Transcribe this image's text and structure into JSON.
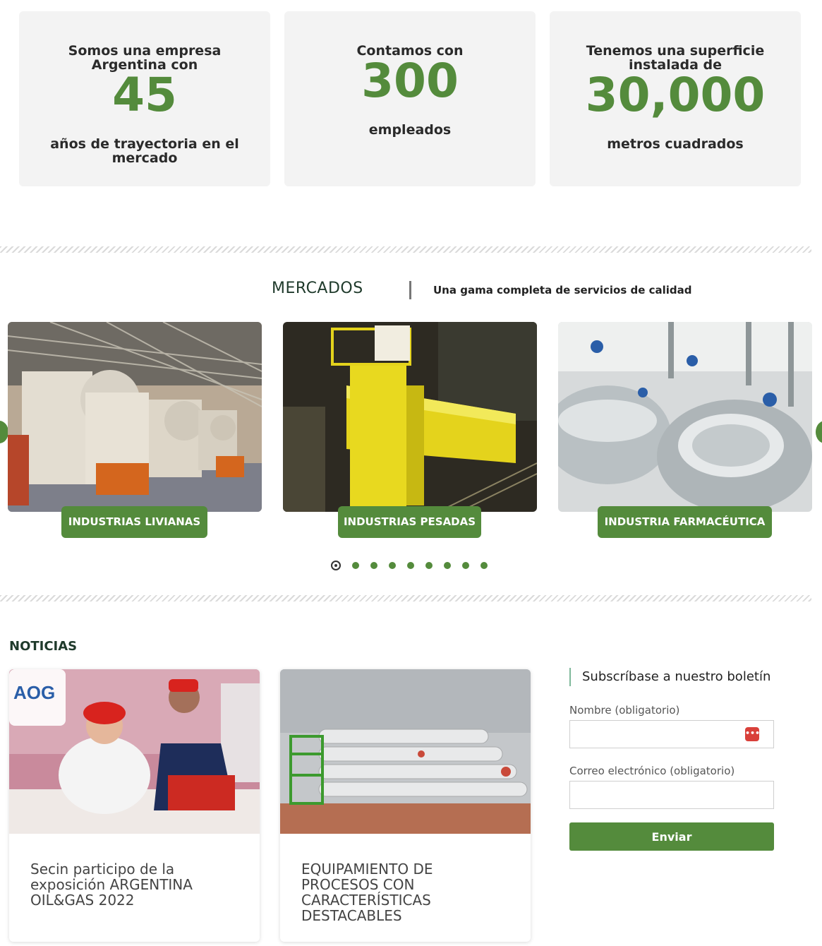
{
  "stats": [
    {
      "before": "Somos una empresa Argentina con",
      "number": "45",
      "after": "años de trayectoria en el mercado"
    },
    {
      "before": "Contamos con",
      "number": "300",
      "after": "empleados"
    },
    {
      "before": "Tenemos una superficie instalada de",
      "number": "30,000",
      "after": "metros cuadrados"
    }
  ],
  "mercados": {
    "title": "MERCADOS",
    "subtitle": "Una gama completa de servicios de calidad",
    "items": [
      {
        "label": "INDUSTRIAS LIVIANAS",
        "image": "factory-presses"
      },
      {
        "label": "INDUSTRIAS PESADAS",
        "image": "yellow-crane"
      },
      {
        "label": "INDUSTRIA FARMACÉUTICA",
        "image": "steel-tanks"
      }
    ],
    "dot_count": 9,
    "active_dot": 1
  },
  "noticias": {
    "heading": "NOTICIAS",
    "items": [
      {
        "title": "Secin participo de la exposición ARGENTINA OIL&GAS 2022",
        "image": "expo-chefs",
        "badge": "AOG"
      },
      {
        "title": "EQUIPAMIENTO DE PROCESOS CON CARACTERÍSTICAS DESTACABLES",
        "image": "gas-cylinders"
      }
    ]
  },
  "newsletter": {
    "title": "Subscríbase a nuestro boletín",
    "name_label": "Nombre (obligatorio)",
    "email_label": "Correo electrónico (obligatorio)",
    "name_value": "",
    "email_value": "",
    "submit_label": "Enviar"
  },
  "colors": {
    "accent": "#548b3c",
    "card_bg": "#f3f3f3"
  }
}
